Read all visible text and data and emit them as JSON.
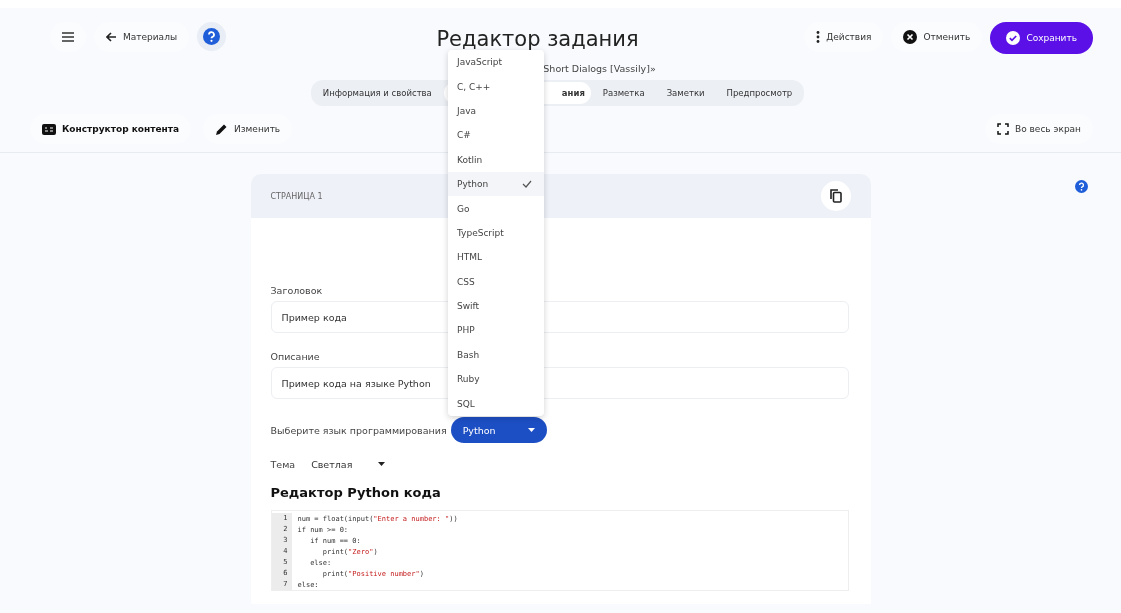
{
  "header": {
    "back_label": "Материалы",
    "title": "Редактор задания",
    "subtitle": "Short Dialogs [Vassily]»",
    "actions": [
      {
        "kind": "menu",
        "label": "Действия"
      },
      {
        "kind": "cancel",
        "label": "Отменить"
      },
      {
        "kind": "save",
        "label": "Сохранить"
      }
    ]
  },
  "tabs": [
    {
      "label": "Информация и свойства",
      "selected": false
    },
    {
      "label": "ания",
      "selected": true
    },
    {
      "label": "Разметка",
      "selected": false
    },
    {
      "label": "Заметки",
      "selected": false
    },
    {
      "label": "Предпросмотр",
      "selected": false
    }
  ],
  "toolbar": {
    "constructor": "Конструктор контента",
    "edit": "Изменить",
    "fullscreen": "Во весь экран"
  },
  "page_card": {
    "title": "СТРАНИЦА 1",
    "fields": [
      {
        "label": "Заголовок",
        "value": "Пример кода"
      },
      {
        "label": "Описание",
        "value": "Пример кода на языке Python"
      }
    ],
    "language": {
      "label": "Выберите язык программирования",
      "value": "Python"
    },
    "theme": {
      "label": "Тема",
      "value": "Светлая"
    },
    "editor_title": "Редактор Python кода",
    "code_lines": [
      {
        "number": "1",
        "tokens": [
          {
            "kind": "plain",
            "text": "num = float(input("
          },
          {
            "kind": "string",
            "text": "\"Enter a number: \""
          },
          {
            "kind": "plain",
            "text": "))"
          }
        ]
      },
      {
        "number": "2",
        "tokens": [
          {
            "kind": "plain",
            "text": "if num >= 0:"
          }
        ]
      },
      {
        "number": "3",
        "tokens": [
          {
            "kind": "plain",
            "text": "   if num == 0:"
          }
        ]
      },
      {
        "number": "4",
        "tokens": [
          {
            "kind": "plain",
            "text": "      print("
          },
          {
            "kind": "string",
            "text": "\"Zero\""
          },
          {
            "kind": "plain",
            "text": ")"
          }
        ]
      },
      {
        "number": "5",
        "tokens": [
          {
            "kind": "plain",
            "text": "   else:"
          }
        ]
      },
      {
        "number": "6",
        "tokens": [
          {
            "kind": "plain",
            "text": "      print("
          },
          {
            "kind": "string",
            "text": "\"Positive number\""
          },
          {
            "kind": "plain",
            "text": ")"
          }
        ]
      },
      {
        "number": "7",
        "tokens": [
          {
            "kind": "plain",
            "text": "else:"
          }
        ]
      }
    ]
  },
  "language_dropdown": [
    {
      "label": "JavaScript",
      "selected": false
    },
    {
      "label": "C, C++",
      "selected": false
    },
    {
      "label": "Java",
      "selected": false
    },
    {
      "label": "C#",
      "selected": false
    },
    {
      "label": "Kotlin",
      "selected": false
    },
    {
      "label": "Python",
      "selected": true
    },
    {
      "label": "Go",
      "selected": false
    },
    {
      "label": "TypeScript",
      "selected": false
    },
    {
      "label": "HTML",
      "selected": false
    },
    {
      "label": "CSS",
      "selected": false
    },
    {
      "label": "Swift",
      "selected": false
    },
    {
      "label": "PHP",
      "selected": false
    },
    {
      "label": "Bash",
      "selected": false
    },
    {
      "label": "Ruby",
      "selected": false
    },
    {
      "label": "SQL",
      "selected": false
    }
  ]
}
